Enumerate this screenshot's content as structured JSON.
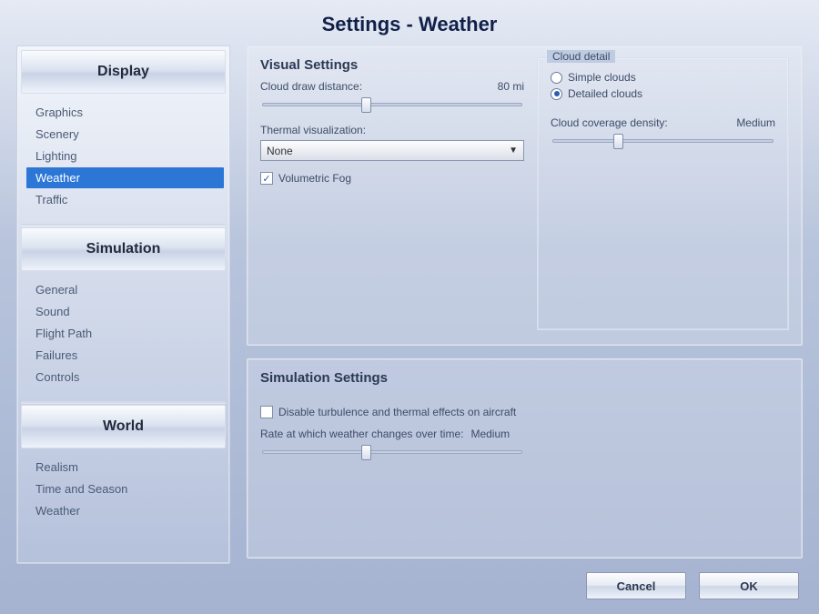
{
  "window_title": "Settings - Weather",
  "sidebar": {
    "sections": [
      {
        "header": "Display",
        "items": [
          "Graphics",
          "Scenery",
          "Lighting",
          "Weather",
          "Traffic"
        ],
        "selected_index": 3
      },
      {
        "header": "Simulation",
        "items": [
          "General",
          "Sound",
          "Flight Path",
          "Failures",
          "Controls"
        ],
        "selected_index": -1
      },
      {
        "header": "World",
        "items": [
          "Realism",
          "Time and Season",
          "Weather"
        ],
        "selected_index": -1
      }
    ]
  },
  "visual": {
    "panel_title": "Visual Settings",
    "cloud_draw_label": "Cloud draw distance:",
    "cloud_draw_value": "80 mi",
    "cloud_draw_pos_pct": 40,
    "thermal_label": "Thermal visualization:",
    "thermal_value": "None",
    "volumetric_fog_label": "Volumetric Fog",
    "volumetric_fog_checked": true,
    "cloud_detail_legend": "Cloud detail",
    "cloud_simple_label": "Simple clouds",
    "cloud_detailed_label": "Detailed clouds",
    "cloud_detail_selected": "detailed",
    "coverage_label": "Cloud coverage density:",
    "coverage_value": "Medium",
    "coverage_pos_pct": 30
  },
  "sim": {
    "panel_title": "Simulation Settings",
    "disable_turbulence_label": "Disable turbulence and thermal effects on aircraft",
    "disable_turbulence_checked": false,
    "rate_label": "Rate at which weather changes over time:",
    "rate_value": "Medium",
    "rate_pos_pct": 40
  },
  "buttons": {
    "cancel": "Cancel",
    "ok": "OK"
  }
}
